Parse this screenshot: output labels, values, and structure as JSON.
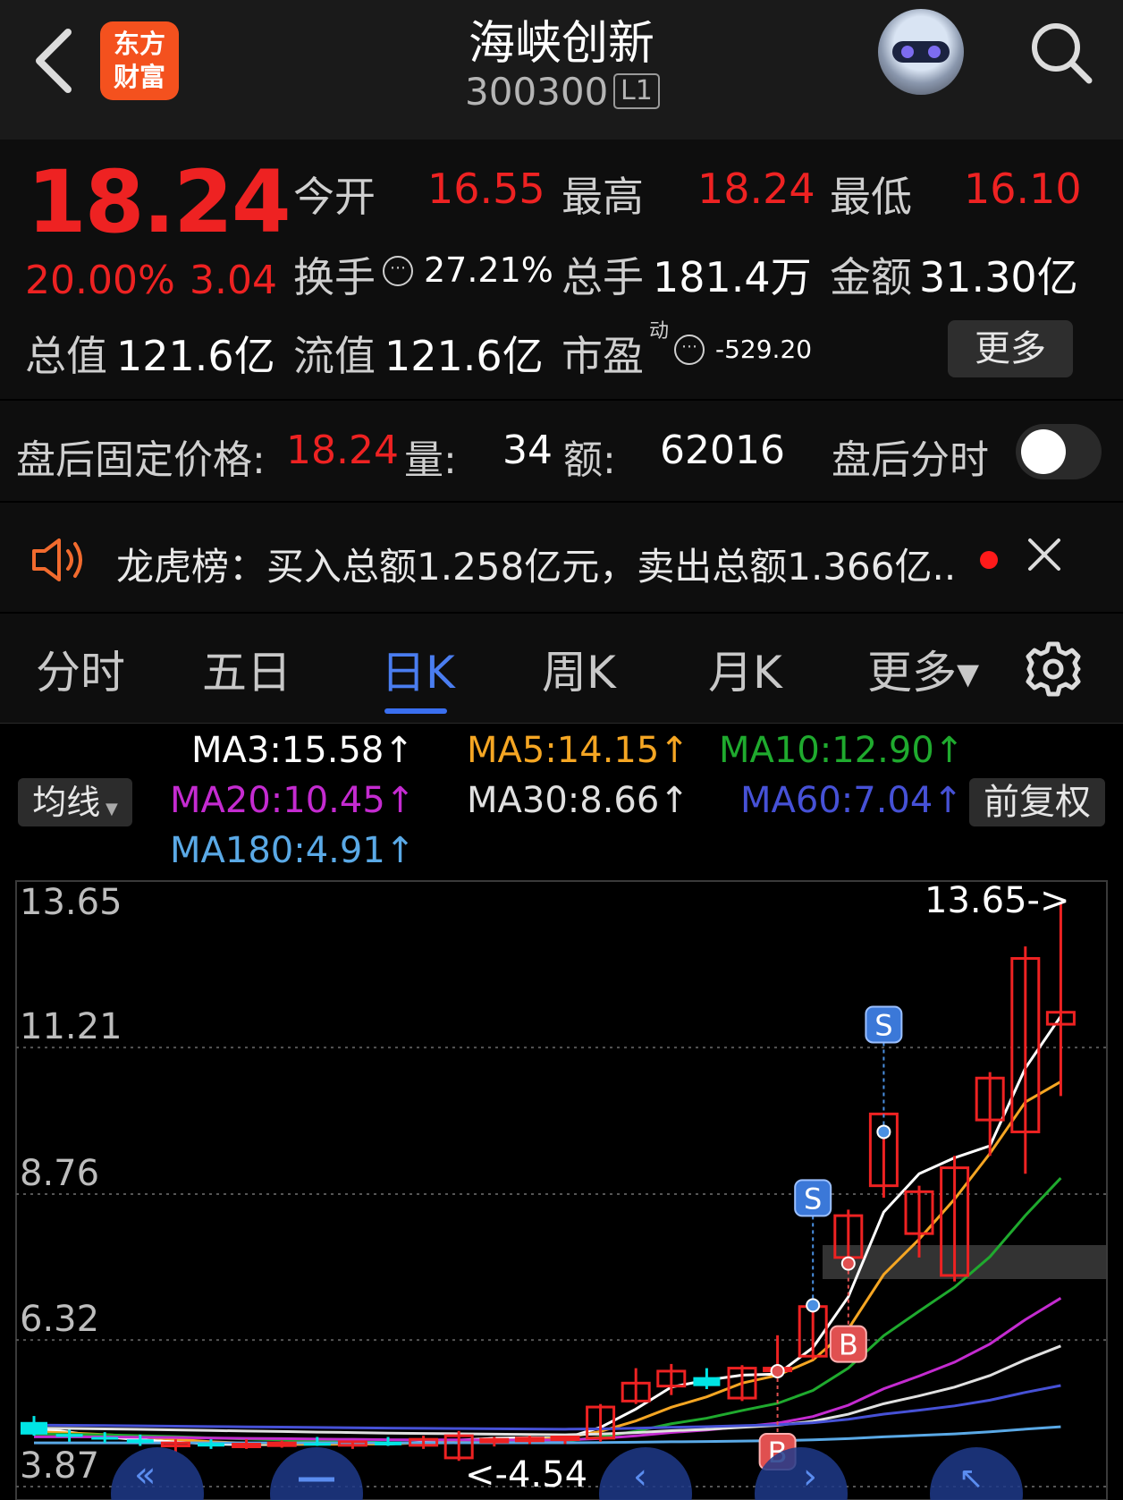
{
  "header": {
    "logo_line1": "东方",
    "logo_line2": "财富",
    "title": "海峡创新",
    "code": "300300",
    "level": "L1"
  },
  "quote": {
    "price": "18.24",
    "change_pct": "20.00%",
    "change": "3.04",
    "open_label": "今开",
    "open": "16.55",
    "high_label": "最高",
    "high": "18.24",
    "low_label": "最低",
    "low": "16.10",
    "turnover_label": "换手",
    "turnover": "27.21%",
    "volume_label": "总手",
    "volume": "181.4万",
    "amount_label": "金额",
    "amount": "31.30亿",
    "mktcap_label": "总值",
    "mktcap": "121.6亿",
    "float_label": "流值",
    "float": "121.6亿",
    "pe_label": "市盈",
    "pe_sup": "动",
    "pe": "-529.20",
    "more": "更多"
  },
  "after_hours": {
    "label": "盘后固定价格:",
    "price": "18.24",
    "vol_label": "量:",
    "vol": "34",
    "amt_label": "额:",
    "amt": "62016",
    "intraday_label": "盘后分时",
    "toggle_on": false
  },
  "news": {
    "text": "龙虎榜：买入总额1.258亿元，卖出总额1.366亿..."
  },
  "tabs": [
    "分时",
    "五日",
    "日K",
    "周K",
    "月K",
    "更多▾"
  ],
  "active_tab": "日K",
  "ma_legend": {
    "button": "均线",
    "adjust": "前复权",
    "ma3": "MA3:15.58↑",
    "ma5": "MA5:14.15↑",
    "ma10": "MA10:12.90↑",
    "ma20": "MA20:10.45↑",
    "ma30": "MA30:8.66↑",
    "ma60": "MA60:7.04↑",
    "ma180": "MA180:4.91↑"
  },
  "colors": {
    "up": "#ee2222",
    "down": "#00e5e5",
    "ma3": "#ffffff",
    "ma5": "#f5a623",
    "ma10": "#1faa2e",
    "ma20": "#c42bd0",
    "ma30": "#e0e0e0",
    "ma60": "#4651d6",
    "ma180": "#5aa9e6"
  },
  "chart_data": {
    "type": "candlestick",
    "y_ticks": [
      "13.65",
      "11.21",
      "8.76",
      "6.32",
      "3.87"
    ],
    "max_label": "13.65->",
    "min_label": "<-4.54",
    "ylim": [
      3.87,
      13.65
    ],
    "candles": [
      {
        "o": 4.95,
        "h": 5.05,
        "l": 4.72,
        "c": 4.74
      },
      {
        "o": 4.75,
        "h": 4.82,
        "l": 4.62,
        "c": 4.7
      },
      {
        "o": 4.7,
        "h": 4.78,
        "l": 4.6,
        "c": 4.66
      },
      {
        "o": 4.66,
        "h": 4.74,
        "l": 4.55,
        "c": 4.6
      },
      {
        "o": 4.55,
        "h": 4.66,
        "l": 4.45,
        "c": 4.6
      },
      {
        "o": 4.6,
        "h": 4.66,
        "l": 4.5,
        "c": 4.54
      },
      {
        "o": 4.56,
        "h": 4.66,
        "l": 4.5,
        "c": 4.58
      },
      {
        "o": 4.58,
        "h": 4.64,
        "l": 4.52,
        "c": 4.6
      },
      {
        "o": 4.6,
        "h": 4.7,
        "l": 4.55,
        "c": 4.56
      },
      {
        "o": 4.56,
        "h": 4.64,
        "l": 4.5,
        "c": 4.62
      },
      {
        "o": 4.62,
        "h": 4.7,
        "l": 4.55,
        "c": 4.56
      },
      {
        "o": 4.56,
        "h": 4.72,
        "l": 4.5,
        "c": 4.66
      },
      {
        "o": 4.35,
        "h": 4.8,
        "l": 4.3,
        "c": 4.72
      },
      {
        "o": 4.64,
        "h": 4.7,
        "l": 4.54,
        "c": 4.66
      },
      {
        "o": 4.65,
        "h": 4.72,
        "l": 4.58,
        "c": 4.68
      },
      {
        "o": 4.68,
        "h": 4.72,
        "l": 4.58,
        "c": 4.7
      },
      {
        "o": 4.68,
        "h": 5.25,
        "l": 4.62,
        "c": 5.2
      },
      {
        "o": 5.3,
        "h": 5.85,
        "l": 5.25,
        "c": 5.6
      },
      {
        "o": 5.55,
        "h": 5.92,
        "l": 5.4,
        "c": 5.8
      },
      {
        "o": 5.7,
        "h": 5.85,
        "l": 5.5,
        "c": 5.55
      },
      {
        "o": 5.35,
        "h": 5.9,
        "l": 5.3,
        "c": 5.85
      },
      {
        "o": 5.85,
        "h": 6.4,
        "l": 5.8,
        "c": 5.85
      },
      {
        "o": 6.05,
        "h": 6.9,
        "l": 6.0,
        "c": 6.88
      },
      {
        "o": 7.7,
        "h": 8.5,
        "l": 7.6,
        "c": 8.4
      },
      {
        "o": 8.9,
        "h": 9.8,
        "l": 8.7,
        "c": 10.1
      },
      {
        "o": 8.1,
        "h": 8.9,
        "l": 7.7,
        "c": 8.8
      },
      {
        "o": 7.4,
        "h": 9.4,
        "l": 7.3,
        "c": 9.2
      },
      {
        "o": 10.0,
        "h": 10.8,
        "l": 9.4,
        "c": 10.7
      },
      {
        "o": 9.8,
        "h": 12.9,
        "l": 9.1,
        "c": 12.7
      },
      {
        "o": 11.6,
        "h": 13.65,
        "l": 10.4,
        "c": 11.8
      }
    ]
  },
  "markers": [
    {
      "label": "S",
      "candle": 24,
      "kind": "sell"
    },
    {
      "label": "S",
      "candle": 22,
      "kind": "sell"
    },
    {
      "label": "B",
      "candle": 23,
      "kind": "buy"
    },
    {
      "label": "B",
      "candle": 21,
      "kind": "buy"
    }
  ]
}
